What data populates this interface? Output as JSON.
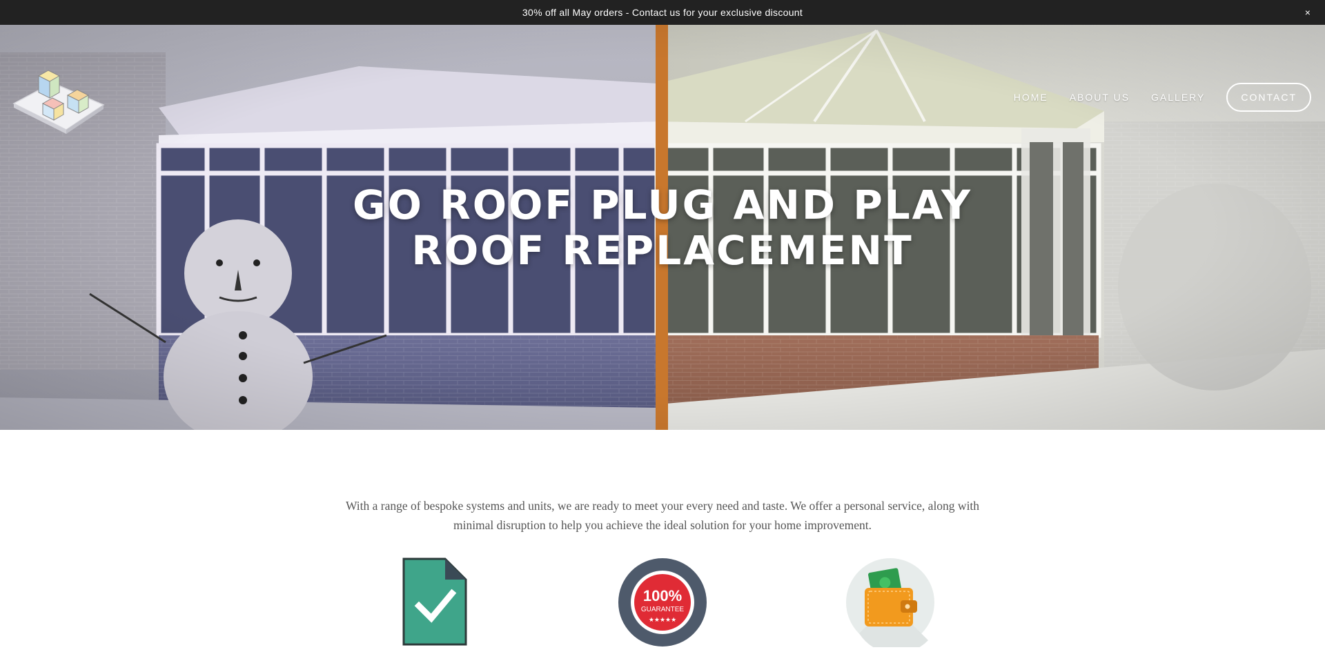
{
  "announcement": {
    "text": "30% off all May orders - Contact us for your exclusive discount",
    "close_label": "×"
  },
  "nav": {
    "items": [
      {
        "label": "HOME"
      },
      {
        "label": "ABOUT US"
      },
      {
        "label": "GALLERY"
      }
    ],
    "contact_label": "CONTACT"
  },
  "hero": {
    "title_line1": "GO ROOF PLUG AND PLAY",
    "title_line2": "ROOF REPLACEMENT"
  },
  "intro": {
    "text": "With a range of bespoke systems and units, we are ready to meet your every need and taste. We offer a personal service, along with minimal disruption to help you achieve the ideal solution for your home improvement."
  },
  "features": [
    {
      "icon": "document-check-icon"
    },
    {
      "icon": "guarantee-badge-icon",
      "badge_value": "100%",
      "badge_text": "GUARANTEE"
    },
    {
      "icon": "wallet-icon"
    }
  ],
  "colors": {
    "announce_bg": "#222222",
    "doc_green": "#3fa58a",
    "badge_red": "#e02b35",
    "badge_ring": "#4e5a6b",
    "wallet_orange": "#f29a1e"
  }
}
